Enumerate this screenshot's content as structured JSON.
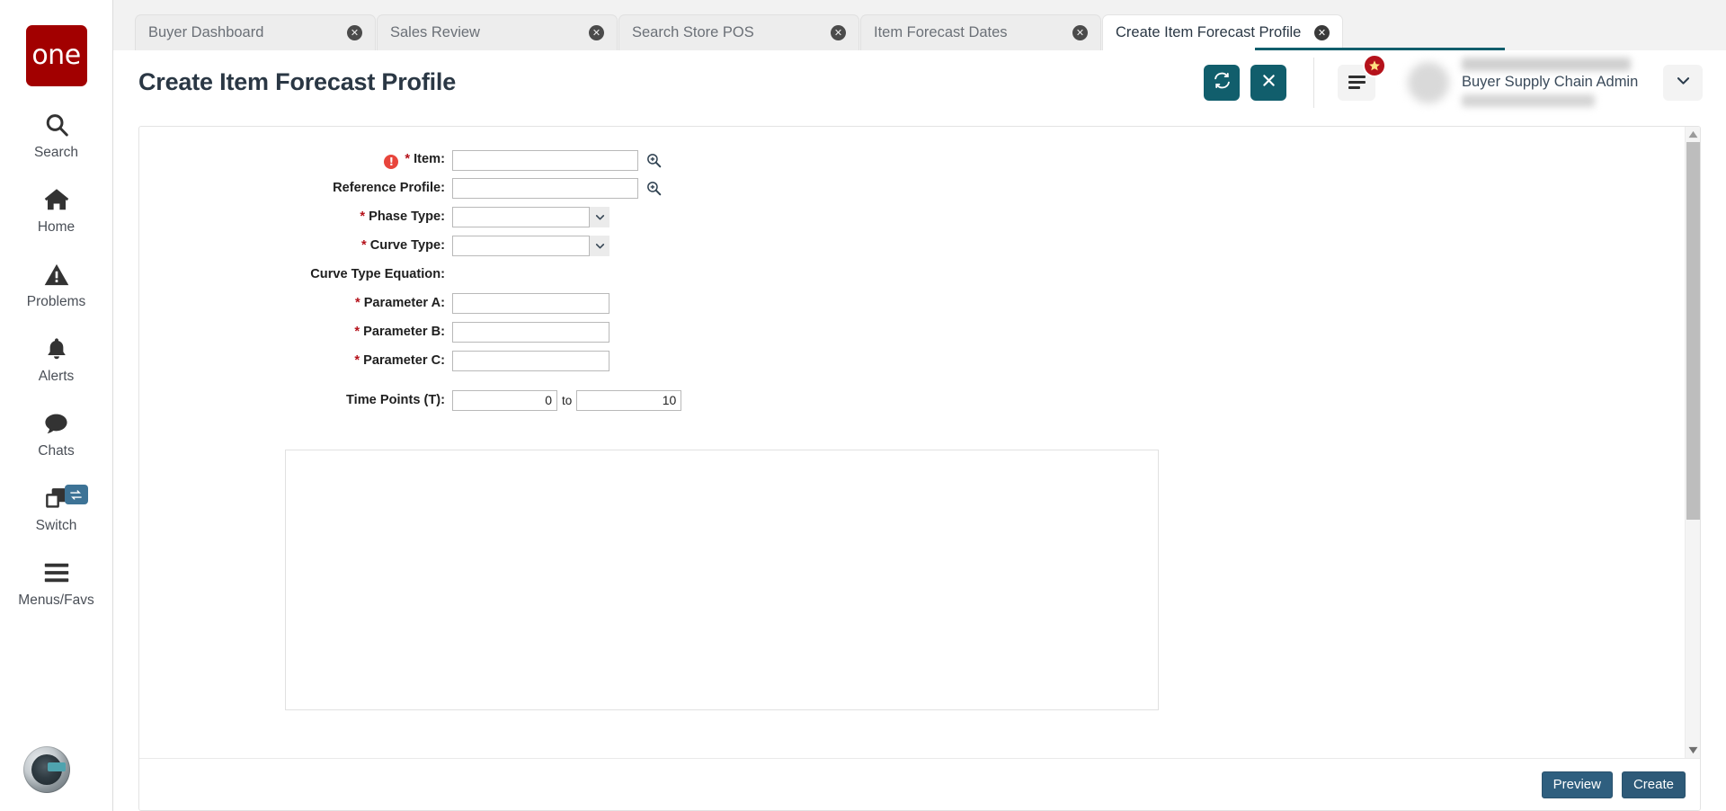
{
  "sidebar": {
    "logo_text": "one",
    "items": [
      {
        "label": "Search",
        "icon": "search-icon"
      },
      {
        "label": "Home",
        "icon": "home-icon"
      },
      {
        "label": "Problems",
        "icon": "warning-triangle-icon"
      },
      {
        "label": "Alerts",
        "icon": "bell-icon"
      },
      {
        "label": "Chats",
        "icon": "chat-bubble-icon"
      },
      {
        "label": "Switch",
        "icon": "windows-switch-icon"
      },
      {
        "label": "Menus/Favs",
        "icon": "hamburger-icon"
      }
    ]
  },
  "tabs": [
    {
      "label": "Buyer Dashboard",
      "close": "✕",
      "active": false
    },
    {
      "label": "Sales Review",
      "close": "✕",
      "active": false
    },
    {
      "label": "Search Store POS",
      "close": "✕",
      "active": false
    },
    {
      "label": "Item Forecast Dates",
      "close": "✕",
      "active": false
    },
    {
      "label": "Create Item Forecast Profile",
      "close": "✕",
      "active": true
    }
  ],
  "header": {
    "title": "Create Item Forecast Profile",
    "refresh_icon": "refresh-icon",
    "close_icon": "close-icon",
    "menu_icon": "hamburger-icon",
    "favorite_badge_icon": "star-icon",
    "caret_icon": "chevron-down-icon",
    "accent_color": "#115e6c"
  },
  "user": {
    "role": "Buyer Supply Chain Admin"
  },
  "form": {
    "fields": [
      {
        "label": "Item:",
        "required": true,
        "has_error": true,
        "error_icon": "error-icon",
        "type": "text-picker",
        "value": "",
        "picker_icon": "search-plus-icon"
      },
      {
        "label": "Reference Profile:",
        "required": false,
        "has_error": false,
        "type": "text-picker",
        "value": "",
        "picker_icon": "search-plus-icon"
      },
      {
        "label": "Phase Type:",
        "required": true,
        "has_error": false,
        "type": "select",
        "value": "",
        "options": [
          ""
        ]
      },
      {
        "label": "Curve Type:",
        "required": true,
        "has_error": false,
        "type": "select",
        "value": "",
        "options": [
          ""
        ]
      },
      {
        "label": "Curve Type Equation:",
        "required": false,
        "has_error": false,
        "type": "static",
        "value": ""
      },
      {
        "label": "Parameter A:",
        "required": true,
        "has_error": false,
        "type": "text",
        "value": ""
      },
      {
        "label": "Parameter B:",
        "required": true,
        "has_error": false,
        "type": "text",
        "value": ""
      },
      {
        "label": "Parameter C:",
        "required": true,
        "has_error": false,
        "type": "text",
        "value": ""
      }
    ],
    "time_points": {
      "label": "Time Points (T):",
      "from": "0",
      "to_label": "to",
      "to": "10"
    }
  },
  "footer": {
    "preview_label": "Preview",
    "create_label": "Create"
  },
  "scrollbar": {
    "up_icon": "triangle-up-icon",
    "down_icon": "triangle-down-icon"
  }
}
